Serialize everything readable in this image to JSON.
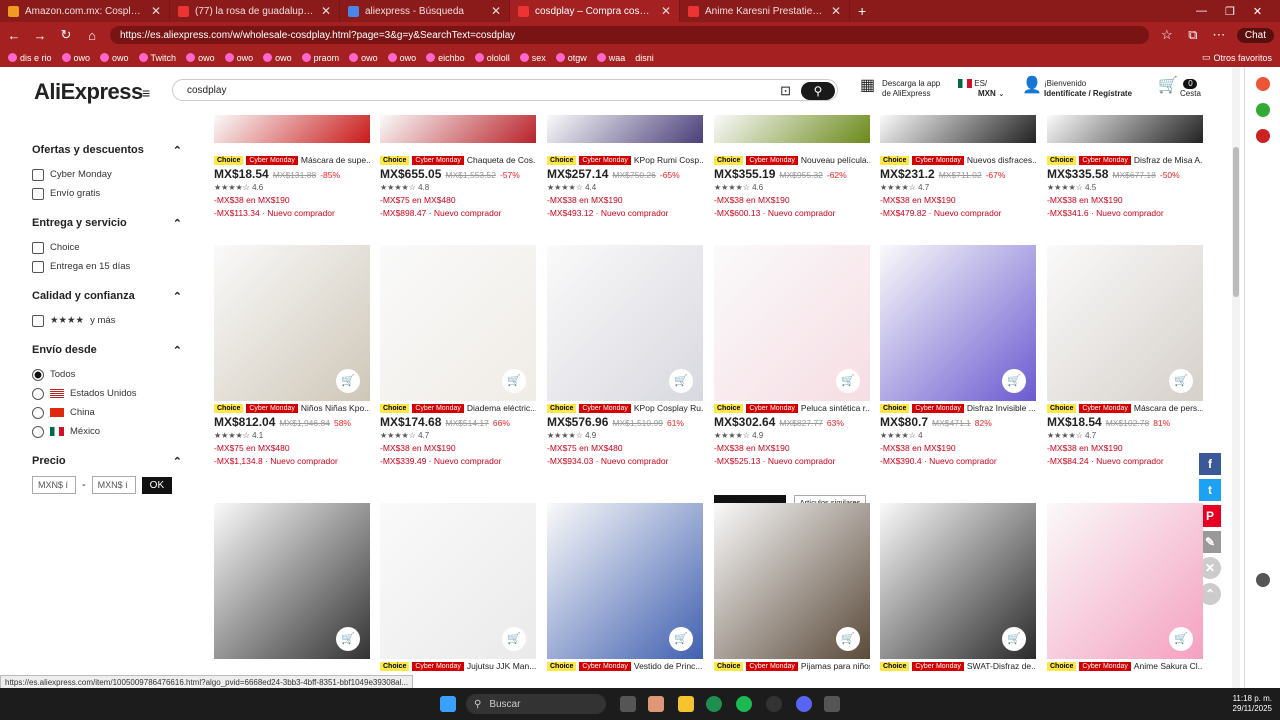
{
  "tabs": [
    {
      "title": "Amazon.com.mx: Cosplay Mujer",
      "color": "#f29a1d"
    },
    {
      "title": "(77) la rosa de guadalupe - YouTube",
      "color": "#ff0000"
    },
    {
      "title": "aliexpress - Búsqueda",
      "color": "#4a86e8"
    },
    {
      "title": "cosdplay – Compra cosdplay con",
      "color": "#e23d2a"
    },
    {
      "title": "Anime Karesni Prestaties Kleding",
      "color": "#e23d2a"
    }
  ],
  "browser": {
    "url": "https://es.aliexpress.com/w/wholesale-cosdplay.html?page=3&g=y&SearchText=cosdplay",
    "chat": "Chat",
    "other_favs": "Otros favoritos"
  },
  "bookmarks": [
    "dis e rio",
    "owo",
    "owo",
    "Twitch",
    "owo",
    "owo",
    "owo",
    "praom",
    "owo",
    "owo",
    "eichbo",
    "olololl",
    "sex",
    "otgw",
    "waa",
    "disni"
  ],
  "header": {
    "logo": "AliExpress",
    "search_value": "cosdplay",
    "app_line1": "Descarga la app",
    "app_line2": "de AliExpress",
    "region": "ES/",
    "currency": "MXN",
    "welcome": "¡Bienvenido",
    "login": "Identifícate / Regístrate",
    "cart_count": "0",
    "cart": "Cesta"
  },
  "sidebar": {
    "sec1": {
      "title": "Ofertas y descuentos",
      "opts": [
        "Cyber Monday",
        "Envío gratis"
      ]
    },
    "sec2": {
      "title": "Entrega y servicio",
      "opts": [
        "Choice",
        "Entrega en 15 días"
      ]
    },
    "sec3": {
      "title": "Calidad y confianza",
      "stars": "★★★★",
      "opt": "y más"
    },
    "sec4": {
      "title": "Envío desde",
      "opts": [
        "Todos",
        "Estados Unidos",
        "China",
        "México"
      ]
    },
    "sec5": {
      "title": "Precio",
      "min": "MXN$ í",
      "dash": "-",
      "max": "MXN$ í",
      "ok": "OK"
    }
  },
  "labels": {
    "choice": "Choice",
    "cyber": "Cyber Monday"
  },
  "row1": [
    {
      "title": "Máscara de supe...",
      "price": "MX$18.54",
      "old": "MX$131.88",
      "disc": "-85%",
      "rating": "★★★★☆ 4.6",
      "promo": "-MX$38 en MX$190",
      "newb": "-MX$113.34 · Nuevo comprador"
    },
    {
      "title": "Chaqueta de Cos...",
      "price": "MX$655.05",
      "old": "MX$1,553.52",
      "disc": "-57%",
      "rating": "★★★★☆ 4.8",
      "promo": "-MX$75 en MX$480",
      "newb": "-MX$898.47 · Nuevo comprador"
    },
    {
      "title": "KPop Rumi Cosp...",
      "price": "MX$257.14",
      "old": "MX$750.26",
      "disc": "-65%",
      "rating": "★★★★☆ 4.4",
      "promo": "-MX$38 en MX$190",
      "newb": "-MX$493.12 · Nuevo comprador"
    },
    {
      "title": "Nouveau película...",
      "price": "MX$355.19",
      "old": "MX$955.32",
      "disc": "-62%",
      "rating": "★★★★☆ 4.6",
      "promo": "-MX$38 en MX$190",
      "newb": "-MX$600.13 · Nuevo comprador"
    },
    {
      "title": "Nuevos disfraces...",
      "price": "MX$231.2",
      "old": "MX$711.02",
      "disc": "-67%",
      "rating": "★★★★☆ 4.7",
      "promo": "-MX$38 en MX$190",
      "newb": "-MX$479.82 · Nuevo comprador"
    },
    {
      "title": "Disfraz de Misa A...",
      "price": "MX$335.58",
      "old": "MX$677.18",
      "disc": "-50%",
      "rating": "★★★★☆ 4.5",
      "promo": "-MX$38 en MX$190",
      "newb": "-MX$341.6 · Nuevo comprador"
    }
  ],
  "row2": [
    {
      "title": "Niños Niñas Kpo...",
      "price": "MX$812.04",
      "old": "MX$1,946.84",
      "disc": "58%",
      "rating": "★★★★☆ 4.1",
      "promo": "-MX$75 en MX$480",
      "newb": "-MX$1,134.8 · Nuevo comprador"
    },
    {
      "title": "Diadema eléctric...",
      "price": "MX$174.68",
      "old": "MX$514.17",
      "disc": "66%",
      "rating": "★★★★☆ 4.7",
      "promo": "-MX$38 en MX$190",
      "newb": "-MX$339.49 · Nuevo comprador"
    },
    {
      "title": "KPop Cosplay Ru...",
      "price": "MX$576.96",
      "old": "MX$1,510.99",
      "disc": "61%",
      "rating": "★★★★☆ 4.9",
      "promo": "-MX$75 en MX$480",
      "newb": "-MX$934.03 · Nuevo comprador"
    },
    {
      "title": "Peluca sintética r...",
      "price": "MX$302.64",
      "old": "MX$827.77",
      "disc": "63%",
      "rating": "★★★★☆ 4.9",
      "promo": "-MX$38 en MX$190",
      "newb": "-MX$525.13 · Nuevo comprador"
    },
    {
      "title": "Disfraz Invisible ...",
      "price": "MX$80.7",
      "old": "MX$471.1",
      "disc": "82%",
      "rating": "★★★★☆ 4",
      "promo": "-MX$38 en MX$190",
      "newb": "-MX$390.4 · Nuevo comprador"
    },
    {
      "title": "Máscara de pers...",
      "price": "MX$18.54",
      "old": "MX$102.78",
      "disc": "81%",
      "rating": "★★★★☆ 4.7",
      "promo": "-MX$38 en MX$190",
      "newb": "-MX$84.24 · Nuevo comprador"
    }
  ],
  "row3": [
    {
      "title": ""
    },
    {
      "title": "Jujutsu JJK Man..."
    },
    {
      "title": "Vestido de Princ..."
    },
    {
      "title": "Pijamas para niños con dise..."
    },
    {
      "title": "SWAT-Disfraz de..."
    },
    {
      "title": "Anime Sakura Cl..."
    }
  ],
  "hover": {
    "preview": "Previsualizar",
    "similar": "Artículos similares"
  },
  "status_url": "https://es.aliexpress.com/item/1005009786476616.html?algo_pvid=6668ed24-3bb3-4bff-8351-bbf1049e39308al...",
  "taskbar": {
    "search": "Buscar",
    "time": "11:18 p. m.",
    "date": "29/11/2025"
  }
}
